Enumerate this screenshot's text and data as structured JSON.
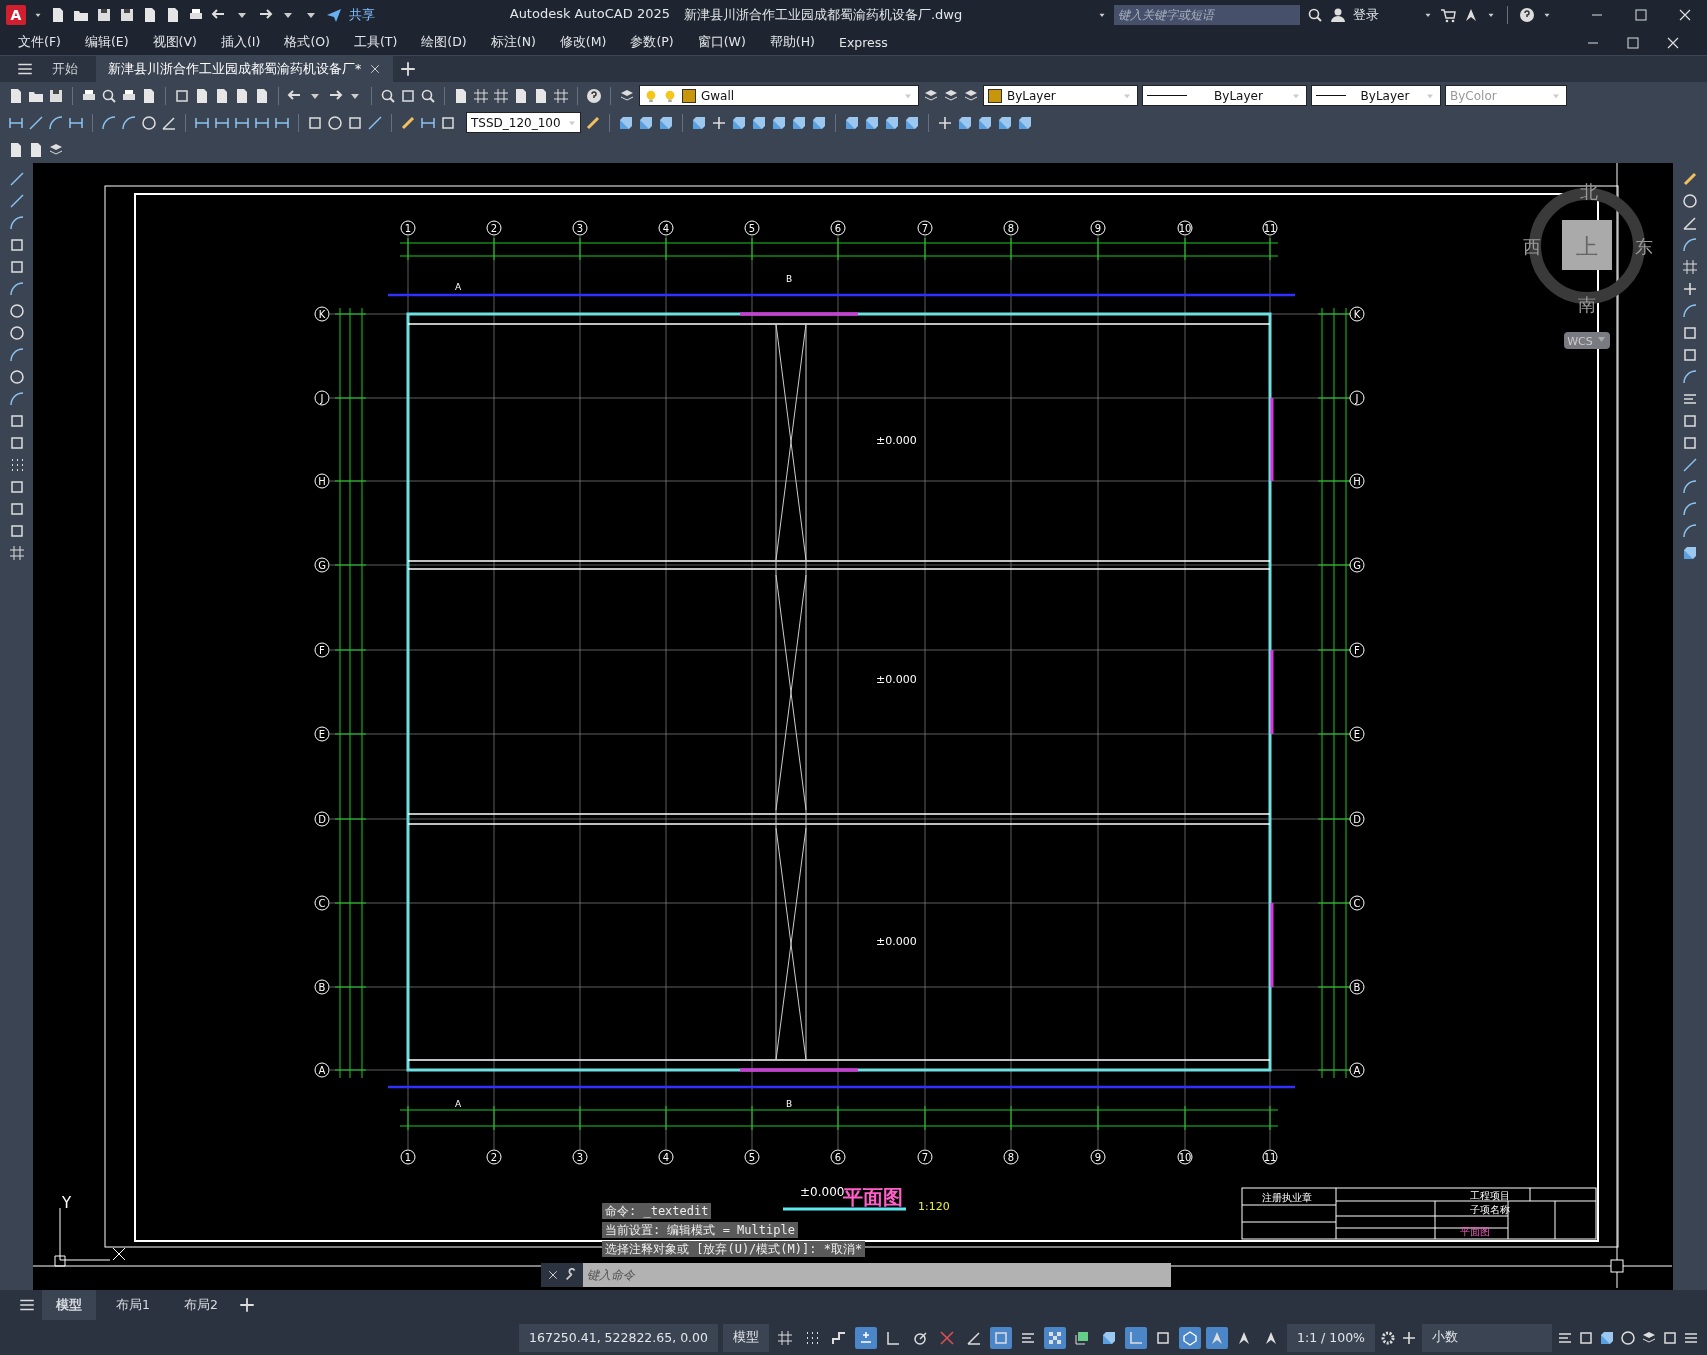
{
  "title_bar": {
    "logo": "A",
    "share": "共享",
    "app_name": "Autodesk AutoCAD 2025",
    "file_name": "新津县川浙合作工业园成都蜀渝药机设备厂.dwg",
    "search": {
      "placeholder": "键入关键字或短语"
    },
    "sign_in": "登录"
  },
  "menu": [
    "文件(F)",
    "编辑(E)",
    "视图(V)",
    "插入(I)",
    "格式(O)",
    "工具(T)",
    "绘图(D)",
    "标注(N)",
    "修改(M)",
    "参数(P)",
    "窗口(W)",
    "帮助(H)",
    "Express"
  ],
  "doc_tabs": [
    {
      "label": "开始",
      "selected": false
    },
    {
      "label": "新津县川浙合作工业园成都蜀渝药机设备厂*",
      "selected": true
    }
  ],
  "toolbar": {
    "layer": "Gwall",
    "text_style": "TSSD_120_100",
    "color_setting": "ByLayer",
    "linetype": "ByLayer",
    "lineweight": "ByLayer",
    "plot_style": "ByColor"
  },
  "viewcube": {
    "north": "北",
    "west": "西",
    "east": "东",
    "south": "南",
    "face": "上",
    "ucs": "WCS"
  },
  "drawing": {
    "top_axes": [
      "1",
      "2",
      "3",
      "4",
      "5",
      "6",
      "7",
      "8",
      "9",
      "10",
      "11"
    ],
    "bottom_axes": [
      "1",
      "2",
      "3",
      "4",
      "5",
      "6",
      "7",
      "8",
      "9",
      "10",
      "11"
    ],
    "left_axes": [
      "K",
      "J",
      "H",
      "G",
      "F",
      "E",
      "D",
      "C",
      "B",
      "A"
    ],
    "right_axes": [
      "K",
      "J",
      "H",
      "G",
      "F",
      "E",
      "D",
      "C",
      "B",
      "A"
    ],
    "elevations": [
      "±0.000",
      "±0.000",
      "±0.000"
    ],
    "top_sections": [
      "A",
      "B"
    ],
    "bottom_sections": [
      "A",
      "B"
    ],
    "title_elevation": "±0.000",
    "title": "平面图",
    "scale": "1:120",
    "title_block": {
      "seal": "注册执业章",
      "project": "工程项目",
      "subitem": "子项名称",
      "sheet_title": "平面图"
    },
    "ucs_y": "Y"
  },
  "command_history": [
    "命令:  _textedit",
    "当前设置: 编辑模式 = Multiple",
    "选择注释对象或 [放弃(U)/模式(M)]: *取消*"
  ],
  "command_input": {
    "placeholder": "键入命令"
  },
  "layout_tabs": [
    {
      "label": "模型",
      "selected": true
    },
    {
      "label": "布局1",
      "selected": false
    },
    {
      "label": "布局2",
      "selected": false
    }
  ],
  "status_bar": {
    "coordinates": "167250.41, 522822.65, 0.00",
    "space": "模型",
    "scale": "1:1 / 100%",
    "units": "小数",
    "toggles": [
      {
        "kind": "grid",
        "on": false
      },
      {
        "kind": "dots",
        "on": false
      },
      {
        "kind": "step",
        "on": false
      },
      {
        "kind": "infer",
        "on": true
      },
      {
        "kind": "ortho",
        "on": false
      },
      {
        "kind": "polar",
        "on": false
      },
      {
        "kind": "track",
        "on": false
      },
      {
        "kind": "angle",
        "on": false
      },
      {
        "kind": "frame",
        "on": true
      },
      {
        "kind": "lines",
        "on": false
      },
      {
        "kind": "checker",
        "on": true
      },
      {
        "kind": "layer",
        "on": false
      },
      {
        "kind": "cube",
        "on": false
      },
      {
        "kind": "axes",
        "on": true
      },
      {
        "kind": "frame",
        "on": false
      },
      {
        "kind": "gizmo",
        "on": true
      },
      {
        "kind": "annot",
        "on": true
      },
      {
        "kind": "annot",
        "on": false
      },
      {
        "kind": "annot",
        "on": false
      }
    ]
  }
}
